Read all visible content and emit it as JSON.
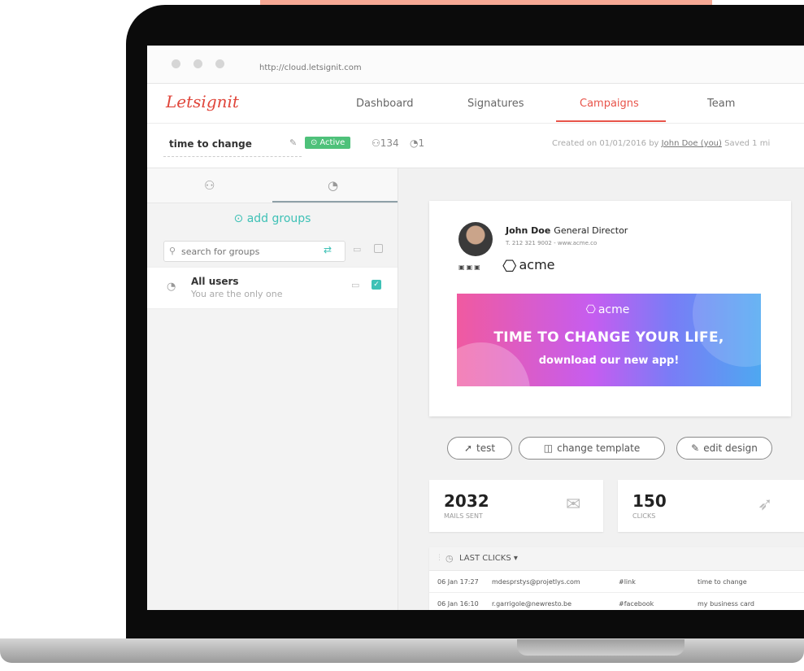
{
  "colors": {
    "brand": "#e0463b",
    "accent": "#e8544a",
    "teal": "#3ec1b6",
    "active_badge": "#4ec17a"
  },
  "browser": {
    "url": "http://cloud.letsignit.com"
  },
  "app": {
    "logo": "Letsignit",
    "nav": [
      {
        "label": "Dashboard"
      },
      {
        "label": "Signatures"
      },
      {
        "label": "Campaigns",
        "active": true
      },
      {
        "label": "Team"
      }
    ]
  },
  "campaign": {
    "name": "time to change",
    "status": "Active",
    "users_count": "134",
    "groups_count": "1",
    "created_prefix": "Created on 01/01/2016 by",
    "created_by": "John Doe (you)",
    "saved": "Saved 1 mi"
  },
  "left_panel": {
    "tab_icons": [
      "user-icon",
      "pie-chart-icon"
    ],
    "add_groups": "add groups",
    "search_placeholder": "search for groups",
    "group": {
      "name": "All users",
      "subtitle": "You are the only one",
      "checked": true
    }
  },
  "signature": {
    "name": "John Doe",
    "title": "General Director",
    "contact": "T. 212 321 9002 - www.acme.co",
    "socials": [
      "facebook-icon",
      "linkedin-icon",
      "twitter-icon"
    ],
    "company": "acme",
    "banner": {
      "brand": "acme",
      "headline": "TIME TO CHANGE YOUR LIFE,",
      "subline": "download our new app!"
    }
  },
  "actions": {
    "test": "test",
    "change_template": "change template",
    "edit_design": "edit design"
  },
  "stats": {
    "mails_sent": {
      "value": "2032",
      "label": "MAILS SENT"
    },
    "clicks": {
      "value": "150",
      "label": "CLICKS"
    }
  },
  "last_clicks": {
    "title": "LAST CLICKS",
    "rows": [
      {
        "time": "06 Jan 17:27",
        "email": "mdesprstys@projetlys.com",
        "link": "#link",
        "signature": "time to change"
      },
      {
        "time": "06 Jan 16:10",
        "email": "r.garrigole@newresto.be",
        "link": "#facebook",
        "signature": "my business card"
      }
    ]
  }
}
